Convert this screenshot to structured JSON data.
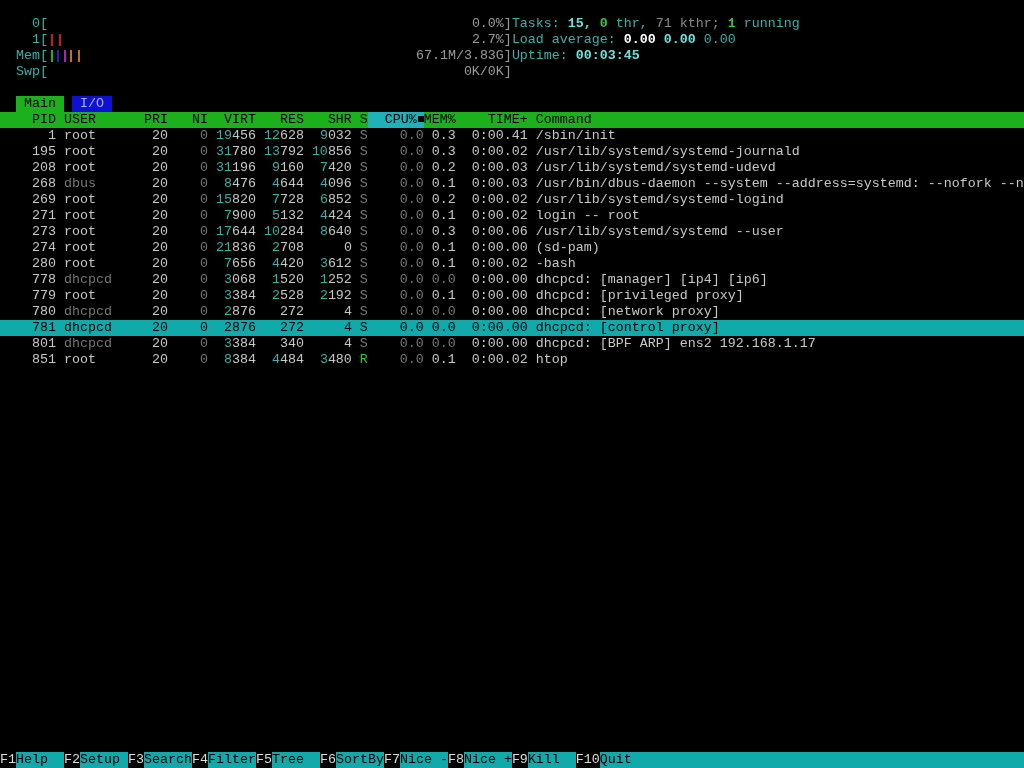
{
  "meters": [
    {
      "label": "0[",
      "value": "0.0%]"
    },
    {
      "label": "1[",
      "value": "2.7%]",
      "segments": [
        {
          "color": "#c02020",
          "level": 0.035
        }
      ]
    },
    {
      "label": "Mem[",
      "value": "67.1M/3.83G]",
      "segments": [
        {
          "color": "#20b020",
          "level": 0.0175
        },
        {
          "color": "#2020c0",
          "level": 0.0175
        },
        {
          "color": "#b020b0",
          "level": 0.0175
        },
        {
          "color": "#c07020",
          "level": 0.035
        }
      ]
    },
    {
      "label": "Swp[",
      "value": "0K/0K]"
    }
  ],
  "info": [
    [
      {
        "text": "Tasks:",
        "kind": "label"
      },
      {
        "text": "15,",
        "kind": "high"
      },
      {
        "text": "0",
        "kind": "green"
      },
      {
        "text": "thr,",
        "kind": "label"
      },
      {
        "text": "71 kthr;",
        "kind": "dim"
      },
      {
        "text": "1",
        "kind": "green"
      },
      {
        "text": "running",
        "kind": "label"
      }
    ],
    [
      {
        "text": "Load average:",
        "kind": "label"
      },
      {
        "text": "0.00",
        "kind": "white"
      },
      {
        "text": "0.00",
        "kind": "high"
      },
      {
        "text": "0.00",
        "kind": "label"
      }
    ],
    [
      {
        "text": "Uptime:",
        "kind": "label"
      },
      {
        "text": "00:03:45",
        "kind": "high"
      }
    ]
  ],
  "tabs": [
    {
      "label": "Main",
      "selected": true
    },
    {
      "label": "I/O",
      "selected": false
    }
  ],
  "columns": [
    {
      "label": "PID",
      "kind": "pid",
      "selected": false
    },
    {
      "label": "USER",
      "kind": "user",
      "selected": false
    },
    {
      "label": "PRI",
      "kind": "num",
      "selected": false
    },
    {
      "label": "NI",
      "kind": "zero",
      "selected": false
    },
    {
      "label": "VIRT",
      "kind": "big",
      "selected": false
    },
    {
      "label": "RES",
      "kind": "big",
      "selected": false
    },
    {
      "label": "SHR",
      "kind": "big",
      "selected": false
    },
    {
      "label": "S",
      "kind": "state",
      "selected": false
    },
    {
      "label": "CPU%",
      "kind": "zero",
      "selected": true
    },
    {
      "label": "MEM%",
      "kind": "zero",
      "selected": false
    },
    {
      "label": "TIME+",
      "kind": "num",
      "selected": false
    },
    {
      "label": "Command",
      "kind": "cmd",
      "selected": false
    }
  ],
  "processes": [
    {
      "cells": [
        "1",
        "root",
        "20",
        "0",
        [
          "19",
          "456"
        ],
        [
          "12",
          "628"
        ],
        [
          "9",
          "032"
        ],
        "S",
        "0.0",
        "0.3",
        "0:00.41",
        "/sbin/init"
      ],
      "dimmed": false,
      "running": false,
      "selected": false
    },
    {
      "cells": [
        "195",
        "root",
        "20",
        "0",
        [
          "31",
          "780"
        ],
        [
          "13",
          "792"
        ],
        [
          "10",
          "856"
        ],
        "S",
        "0.0",
        "0.3",
        "0:00.02",
        "/usr/lib/systemd/systemd-journald"
      ],
      "dimmed": false,
      "running": false,
      "selected": false
    },
    {
      "cells": [
        "208",
        "root",
        "20",
        "0",
        [
          "31",
          "196"
        ],
        [
          "9",
          "160"
        ],
        [
          "7",
          "420"
        ],
        "S",
        "0.0",
        "0.2",
        "0:00.03",
        "/usr/lib/systemd/systemd-udevd"
      ],
      "dimmed": false,
      "running": false,
      "selected": false
    },
    {
      "cells": [
        "268",
        "dbus",
        "20",
        "0",
        [
          "8",
          "476"
        ],
        [
          "4",
          "644"
        ],
        [
          "4",
          "096"
        ],
        "S",
        "0.0",
        "0.1",
        "0:00.03",
        "/usr/bin/dbus-daemon --system --address=systemd: --nofork --n"
      ],
      "dimmed": true,
      "running": false,
      "selected": false
    },
    {
      "cells": [
        "269",
        "root",
        "20",
        "0",
        [
          "15",
          "820"
        ],
        [
          "7",
          "728"
        ],
        [
          "6",
          "852"
        ],
        "S",
        "0.0",
        "0.2",
        "0:00.02",
        "/usr/lib/systemd/systemd-logind"
      ],
      "dimmed": false,
      "running": false,
      "selected": false
    },
    {
      "cells": [
        "271",
        "root",
        "20",
        "0",
        [
          "7",
          "900"
        ],
        [
          "5",
          "132"
        ],
        [
          "4",
          "424"
        ],
        "S",
        "0.0",
        "0.1",
        "0:00.02",
        "login -- root"
      ],
      "dimmed": false,
      "running": false,
      "selected": false
    },
    {
      "cells": [
        "273",
        "root",
        "20",
        "0",
        [
          "17",
          "644"
        ],
        [
          "10",
          "284"
        ],
        [
          "8",
          "640"
        ],
        "S",
        "0.0",
        "0.3",
        "0:00.06",
        "/usr/lib/systemd/systemd --user"
      ],
      "dimmed": false,
      "running": false,
      "selected": false
    },
    {
      "cells": [
        "274",
        "root",
        "20",
        "0",
        [
          "21",
          "836"
        ],
        [
          "2",
          "708"
        ],
        [
          "0"
        ],
        "S",
        "0.0",
        "0.1",
        "0:00.00",
        "(sd-pam)"
      ],
      "dimmed": false,
      "running": false,
      "selected": false
    },
    {
      "cells": [
        "280",
        "root",
        "20",
        "0",
        [
          "7",
          "656"
        ],
        [
          "4",
          "420"
        ],
        [
          "3",
          "612"
        ],
        "S",
        "0.0",
        "0.1",
        "0:00.02",
        "-bash"
      ],
      "dimmed": false,
      "running": false,
      "selected": false
    },
    {
      "cells": [
        "778",
        "dhcpcd",
        "20",
        "0",
        [
          "3",
          "068"
        ],
        [
          "1",
          "520"
        ],
        [
          "1",
          "252"
        ],
        "S",
        "0.0",
        "0.0",
        "0:00.00",
        "dhcpcd: [manager] [ip4] [ip6]"
      ],
      "dimmed": true,
      "running": false,
      "selected": false
    },
    {
      "cells": [
        "779",
        "root",
        "20",
        "0",
        [
          "3",
          "384"
        ],
        [
          "2",
          "528"
        ],
        [
          "2",
          "192"
        ],
        "S",
        "0.0",
        "0.1",
        "0:00.00",
        "dhcpcd: [privileged proxy]"
      ],
      "dimmed": false,
      "running": false,
      "selected": false
    },
    {
      "cells": [
        "780",
        "dhcpcd",
        "20",
        "0",
        [
          "2",
          "876"
        ],
        [
          "272"
        ],
        [
          "4"
        ],
        "S",
        "0.0",
        "0.0",
        "0:00.00",
        "dhcpcd: [network proxy]"
      ],
      "dimmed": true,
      "running": false,
      "selected": false
    },
    {
      "cells": [
        "781",
        "dhcpcd",
        "20",
        "0",
        [
          "2",
          "876"
        ],
        [
          "272"
        ],
        [
          "4"
        ],
        "S",
        "0.0",
        "0.0",
        "0:00.00",
        "dhcpcd: [control proxy]"
      ],
      "dimmed": true,
      "running": false,
      "selected": true
    },
    {
      "cells": [
        "801",
        "dhcpcd",
        "20",
        "0",
        [
          "3",
          "384"
        ],
        [
          "340"
        ],
        [
          "4"
        ],
        "S",
        "0.0",
        "0.0",
        "0:00.00",
        "dhcpcd: [BPF ARP] ens2 192.168.1.17"
      ],
      "dimmed": true,
      "running": false,
      "selected": false
    },
    {
      "cells": [
        "851",
        "root",
        "20",
        "0",
        [
          "8",
          "384"
        ],
        [
          "4",
          "484"
        ],
        [
          "3",
          "480"
        ],
        "R",
        "0.0",
        "0.1",
        "0:00.02",
        "htop"
      ],
      "dimmed": false,
      "running": true,
      "selected": false
    }
  ],
  "function_keys": [
    {
      "key": "F1",
      "label": "Help"
    },
    {
      "key": "F2",
      "label": "Setup"
    },
    {
      "key": "F3",
      "label": "Search"
    },
    {
      "key": "F4",
      "label": "Filter"
    },
    {
      "key": "F5",
      "label": "Tree"
    },
    {
      "key": "F6",
      "label": "SortBy"
    },
    {
      "key": "F7",
      "label": "Nice -"
    },
    {
      "key": "F8",
      "label": "Nice +"
    },
    {
      "key": "F9",
      "label": "Kill"
    },
    {
      "key": "F10",
      "label": "Quit"
    }
  ]
}
